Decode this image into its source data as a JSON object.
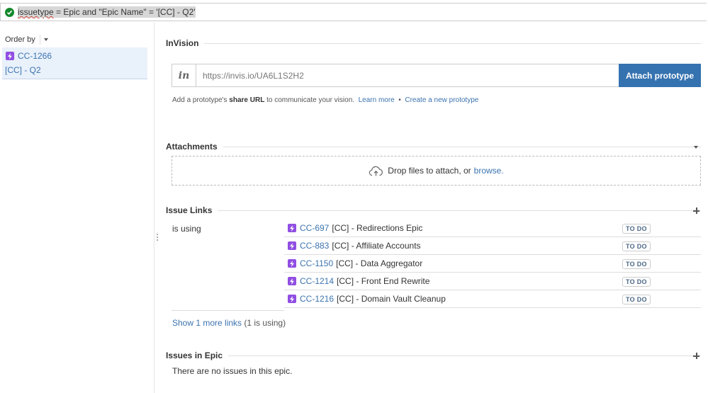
{
  "query": {
    "prefix": "issuetype",
    "rest": " = Epic and \"Epic Name\" = '[CC] - Q2'"
  },
  "sidebar": {
    "order_by_label": "Order by",
    "issue_key": "CC-1266",
    "issue_summary": "[CC] - Q2"
  },
  "invision": {
    "title": "InVision",
    "logo_text": "in",
    "url_value": "https://invis.io/UA6L1S2H2",
    "attach_label": "Attach prototype",
    "help_prefix": "Add a prototype's ",
    "help_bold": "share URL",
    "help_suffix": " to communicate your vision.",
    "learn_more": "Learn more",
    "bullet": "•",
    "create_link": "Create a new prototype"
  },
  "attachments": {
    "title": "Attachments",
    "drop_text": "Drop files to attach, or",
    "browse_link": "browse."
  },
  "issue_links": {
    "title": "Issue Links",
    "relation": "is using",
    "items": [
      {
        "key": "CC-697",
        "summary": "[CC] - Redirections Epic",
        "status": "TO DO"
      },
      {
        "key": "CC-883",
        "summary": "[CC] - Affiliate Accounts",
        "status": "TO DO"
      },
      {
        "key": "CC-1150",
        "summary": "[CC] - Data Aggregator",
        "status": "TO DO"
      },
      {
        "key": "CC-1214",
        "summary": "[CC] - Front End Rewrite",
        "status": "TO DO"
      },
      {
        "key": "CC-1216",
        "summary": "[CC] - Domain Vault Cleanup",
        "status": "TO DO"
      }
    ],
    "show_more_link": "Show 1 more links",
    "show_more_meta": "(1 is using)"
  },
  "issues_in_epic": {
    "title": "Issues in Epic",
    "empty_text": "There are no issues in this epic."
  },
  "colors": {
    "link": "#3b73af",
    "epic": "#904ee2",
    "primary_button": "#3572b0",
    "valid": "#14892c"
  }
}
